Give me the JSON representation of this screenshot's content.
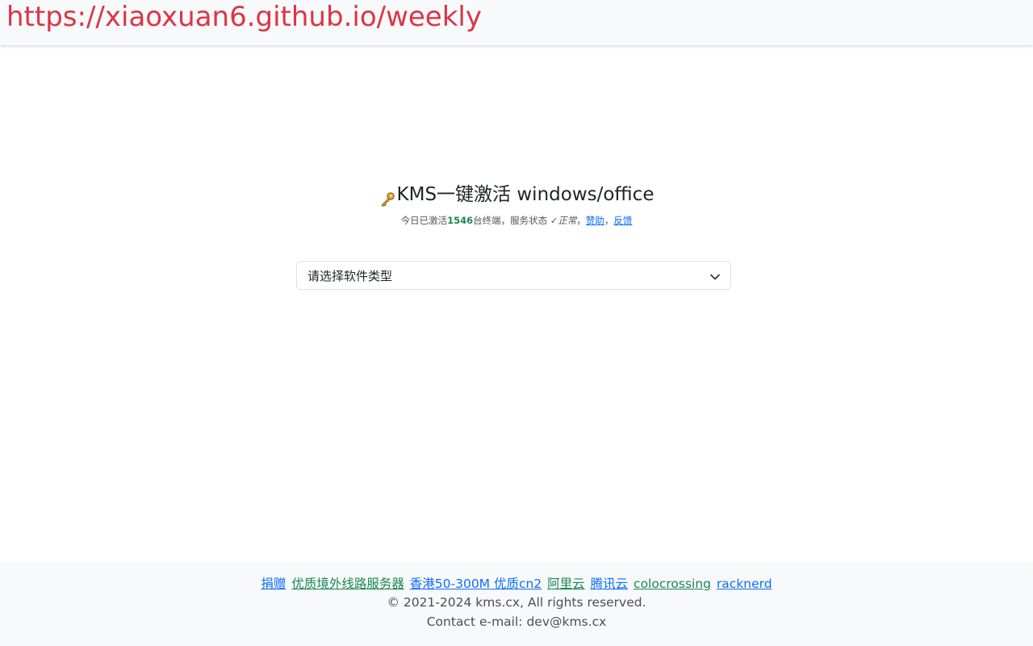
{
  "header": {
    "banner_text": "https://xiaoxuan6.github.io/weekly"
  },
  "hero": {
    "icon": "key-icon",
    "title": "KMS一键激活 windows/office",
    "subtitle": {
      "prefix": "今日已激活",
      "count": "1546",
      "middle": "台终端，服务状态",
      "check": "✓",
      "status": "正常",
      "sep1": "，",
      "donate_link": "赞助",
      "sep2": "，",
      "feedback_link": "反馈"
    }
  },
  "software_select": {
    "selected_value": "请选择软件类型"
  },
  "footer": {
    "links": [
      {
        "label": "捐赠",
        "color": "#0d6efd"
      },
      {
        "label": "优质境外线路服务器",
        "color": "#198754"
      },
      {
        "label": "香港50-300M 优质cn2",
        "color": "#0d6efd"
      },
      {
        "label": "阿里云",
        "color": "#198754"
      },
      {
        "label": "腾讯云",
        "color": "#0d6efd"
      },
      {
        "label": "colocrossing",
        "color": "#198754"
      },
      {
        "label": "racknerd",
        "color": "#0d6efd"
      }
    ],
    "copyright": "© 2021-2024 kms.cx, All rights reserved.",
    "contact": "Contact e-mail: dev@kms.cx"
  },
  "colors": {
    "banner": "#dc3545",
    "count": "#198754",
    "link_blue": "#0d6efd",
    "link_green": "#198754"
  }
}
